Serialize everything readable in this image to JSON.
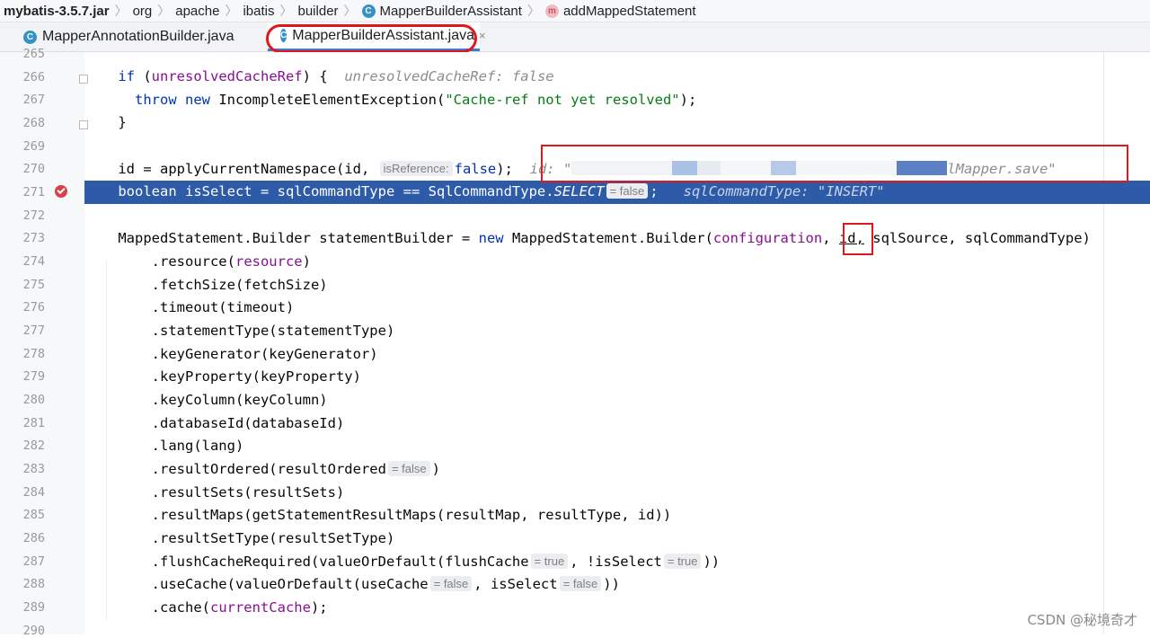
{
  "breadcrumb": {
    "jar": "mybatis-3.5.7.jar",
    "pkg1": "org",
    "pkg2": "apache",
    "pkg3": "ibatis",
    "pkg4": "builder",
    "class_icon": "C",
    "class_name": "MapperBuilderAssistant",
    "method_icon": "m",
    "method_name": "addMappedStatement",
    "separator": "〉"
  },
  "tabs": [
    {
      "icon": "C",
      "label": "MapperAnnotationBuilder.java"
    },
    {
      "icon": "C",
      "label": "MapperBuilderAssistant.java",
      "close": "×"
    }
  ],
  "editor": {
    "line_numbers": [
      "265",
      "266",
      "267",
      "268",
      "269",
      "270",
      "271",
      "272",
      "273",
      "274",
      "275",
      "276",
      "277",
      "278",
      "279",
      "280",
      "281",
      "282",
      "283",
      "284",
      "285",
      "286",
      "287",
      "288",
      "289",
      "290"
    ],
    "line266": {
      "kw": "if",
      "cond_open": " (",
      "var": "unresolvedCacheRef",
      "cond_close": ") {",
      "hint": "unresolvedCacheRef: false"
    },
    "line267": {
      "kw1": "throw",
      "kw2": "new",
      "cls": " IncompleteElementException(",
      "str": "\"Cache-ref not yet resolved\"",
      "tail": ");"
    },
    "line268": "}",
    "line270": {
      "head": "id = applyCurrentNamespace(id, ",
      "inlay": "isReference:",
      "kwval": "false",
      "tail": ");",
      "hint_head": "id: \"",
      "hint_tail": "lMapper.save\""
    },
    "line271": {
      "head": "boolean isSelect = sqlCommandType == SqlCommandType.",
      "const": "SELECT",
      "inlay": "= false",
      "tail": ";",
      "hint": "sqlCommandType: \"INSERT\""
    },
    "line273": {
      "head": "MappedStatement.Builder statementBuilder = ",
      "kw": "new",
      "mid": " MappedStatement.Builder(",
      "fld": "configuration",
      "c1": ", ",
      "id": "id,",
      "tail": " sqlSource, sqlCommandType)"
    },
    "line274": {
      "head": ".resource(",
      "fld": "resource",
      "tail": ")"
    },
    "line275": ".fetchSize(fetchSize)",
    "line276": ".timeout(timeout)",
    "line277": ".statementType(statementType)",
    "line278": ".keyGenerator(keyGenerator)",
    "line279": ".keyProperty(keyProperty)",
    "line280": ".keyColumn(keyColumn)",
    "line281": ".databaseId(databaseId)",
    "line282": ".lang(lang)",
    "line283": {
      "head": ".resultOrdered(resultOrdered",
      "inlay": "= false",
      "tail": ")"
    },
    "line284": ".resultSets(resultSets)",
    "line285": ".resultMaps(getStatementResultMaps(resultMap, resultType, id))",
    "line286": ".resultSetType(resultSetType)",
    "line287": {
      "head": ".flushCacheRequired(valueOrDefault(flushCache",
      "inlay1": "= true",
      "mid": ", !isSelect",
      "inlay2": "= true",
      "tail": "))"
    },
    "line288": {
      "head": ".useCache(valueOrDefault(useCache",
      "inlay1": "= false",
      "mid": ", isSelect",
      "inlay2": "= false",
      "tail": "))"
    },
    "line289": {
      "head": ".cache(",
      "fld": "currentCache",
      "tail": ");"
    }
  },
  "watermark": "CSDN @秘境奇才",
  "colors": {
    "accent": "#2e5ba8",
    "annotation_red": "#e0181e",
    "keyword": "#0033b3",
    "string": "#067d17",
    "field": "#871094"
  }
}
